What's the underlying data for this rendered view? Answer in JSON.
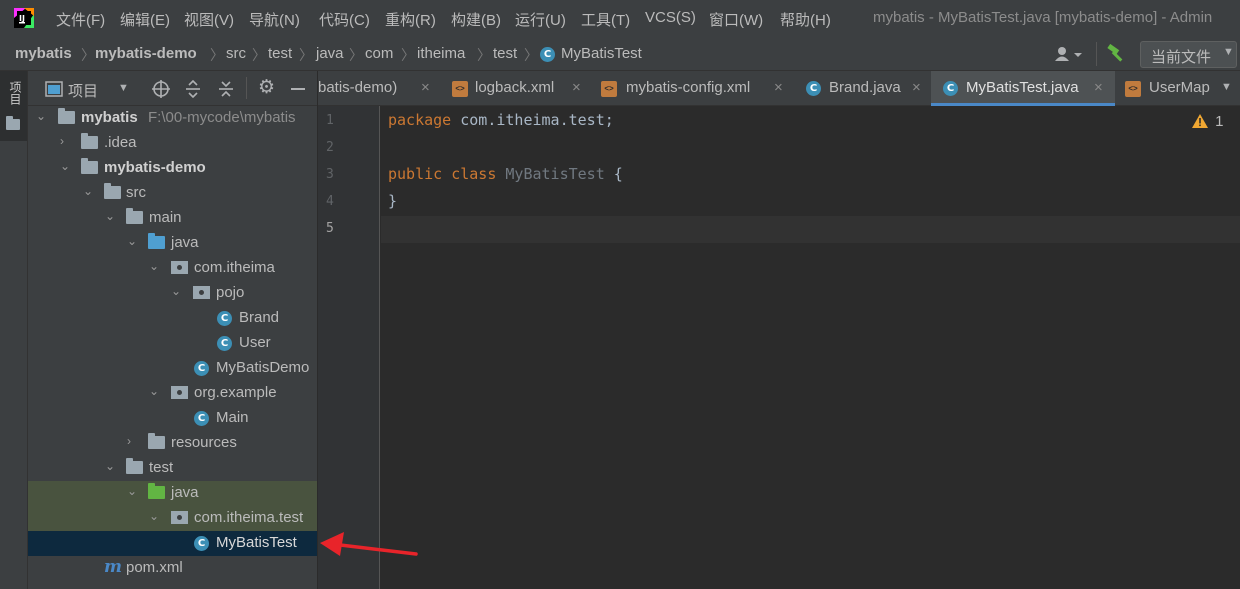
{
  "menu": [
    "文件(F)",
    "编辑(E)",
    "视图(V)",
    "导航(N)",
    "代码(C)",
    "重构(R)",
    "构建(B)",
    "运行(U)",
    "工具(T)",
    "VCS(S)",
    "窗口(W)",
    "帮助(H)"
  ],
  "window_title": "mybatis - MyBatisTest.java [mybatis-demo] - Admin",
  "breadcrumb": [
    "mybatis",
    "mybatis-demo",
    "src",
    "test",
    "java",
    "com",
    "itheima",
    "test",
    "MyBatisTest"
  ],
  "run_config": "当前文件",
  "left_strip_label": "项目",
  "panel": {
    "title": "项目"
  },
  "tree": {
    "root_label": "mybatis",
    "root_path": "F:\\00-mycode\\mybatis",
    "idea": ".idea",
    "module": "mybatis-demo",
    "src": "src",
    "main": "main",
    "main_java": "java",
    "pkg_main": "com.itheima",
    "pojo": "pojo",
    "brand": "Brand",
    "user": "User",
    "demo": "MyBatisDemo",
    "pkg_example": "org.example",
    "main_cls": "Main",
    "resources": "resources",
    "test": "test",
    "test_java": "java",
    "pkg_test": "com.itheima.test",
    "selected": "MyBatisTest",
    "pom": "pom.xml"
  },
  "tabs": [
    "batis-demo)",
    "logback.xml",
    "mybatis-config.xml",
    "Brand.java",
    "MyBatisTest.java",
    "UserMap"
  ],
  "active_tab": "MyBatisTest.java",
  "line_numbers": [
    "1",
    "2",
    "3",
    "4",
    "5"
  ],
  "code": {
    "l1_kw": "package",
    "l1_rest": " com.itheima.test;",
    "l3_kw1": "public",
    "l3_kw2": "class",
    "l3_name": "MyBatisTest",
    "l3_brace": " {",
    "l4": "}"
  },
  "warning_count": "1",
  "colors": {
    "accent": "#4a88c7",
    "selection": "#0d293e",
    "annotation_arrow": "#e8242a"
  }
}
